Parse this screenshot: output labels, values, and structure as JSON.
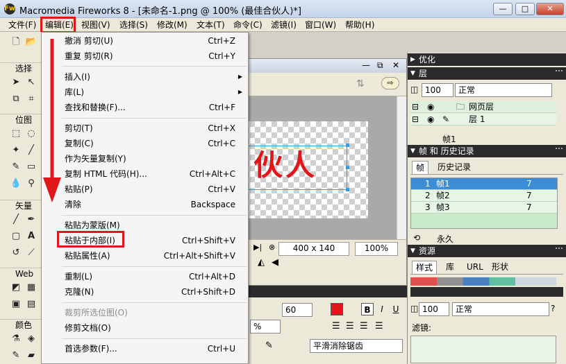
{
  "window": {
    "title": "Macromedia Fireworks 8 - [未命名-1.png @ 100% (最佳合伙人)*]",
    "logo": "Fw",
    "buttons": {
      "minimize": "—",
      "maximize": "□",
      "close": "✕"
    }
  },
  "menubar": {
    "items": [
      "文件(F)",
      "编辑(E)",
      "视图(V)",
      "选择(S)",
      "修改(M)",
      "文本(T)",
      "命令(C)",
      "滤镜(I)",
      "窗口(W)",
      "帮助(H)"
    ],
    "highlighted": "编辑(E)"
  },
  "tools": {
    "sections": [
      "选择",
      "位图",
      "矢量",
      "Web",
      "颜色"
    ]
  },
  "edit_menu": {
    "items": [
      {
        "label": "撤消 剪切(U)",
        "shortcut": "Ctrl+Z"
      },
      {
        "label": "重复 剪切(R)",
        "shortcut": "Ctrl+Y"
      },
      {
        "label": "插入(I)",
        "shortcut": "",
        "submenu": true
      },
      {
        "label": "库(L)",
        "shortcut": "",
        "submenu": true
      },
      {
        "label": "查找和替换(F)...",
        "shortcut": "Ctrl+F"
      },
      {
        "label": "剪切(T)",
        "shortcut": "Ctrl+X"
      },
      {
        "label": "复制(C)",
        "shortcut": "Ctrl+C"
      },
      {
        "label": "作为矢量复制(Y)",
        "shortcut": ""
      },
      {
        "label": "复制 HTML 代码(H)...",
        "shortcut": "Ctrl+Alt+C"
      },
      {
        "label": "粘贴(P)",
        "shortcut": "Ctrl+V"
      },
      {
        "label": "清除",
        "shortcut": "Backspace"
      },
      {
        "label": "粘贴为蒙版(M)",
        "shortcut": ""
      },
      {
        "label": "粘贴于内部(I)",
        "shortcut": "Ctrl+Shift+V",
        "highlighted": true
      },
      {
        "label": "粘贴属性(A)",
        "shortcut": "Ctrl+Alt+Shift+V"
      },
      {
        "label": "重制(L)",
        "shortcut": "Ctrl+Alt+D"
      },
      {
        "label": "克隆(N)",
        "shortcut": "Ctrl+Shift+D"
      },
      {
        "label": "裁剪所选位图(O)",
        "shortcut": "",
        "disabled": true
      },
      {
        "label": "修剪文档(O)",
        "shortcut": ""
      },
      {
        "label": "首选参数(F)...",
        "shortcut": "Ctrl+U"
      }
    ]
  },
  "document": {
    "canvas_text": "伙人",
    "canvas_size": "400 x 140",
    "zoom": "100%"
  },
  "panels": {
    "optimize": "优化",
    "layers": {
      "title": "层",
      "opacity": "100",
      "blend": "正常",
      "rows": [
        "网页层",
        "层 1"
      ],
      "frame_label": "帧1"
    },
    "frames": {
      "title": "帧 和 历史记录",
      "tabs": [
        "帧",
        "历史记录"
      ],
      "rows": [
        {
          "name": "帧1",
          "delay": "7"
        },
        {
          "name": "帧2",
          "delay": "7"
        },
        {
          "name": "帧3",
          "delay": "7"
        }
      ],
      "loop": "永久"
    },
    "assets": {
      "title": "资源",
      "tabs": [
        "样式",
        "库",
        "URL",
        "形状"
      ]
    }
  },
  "properties": {
    "font_size": "60",
    "text_color": "#e0161b",
    "opacity": "100",
    "blend": "正常",
    "bold": "B",
    "italic": "I",
    "underline": "U",
    "percent": "%",
    "antialias": "平滑消除锯齿",
    "filters_label": "滤镜:"
  }
}
